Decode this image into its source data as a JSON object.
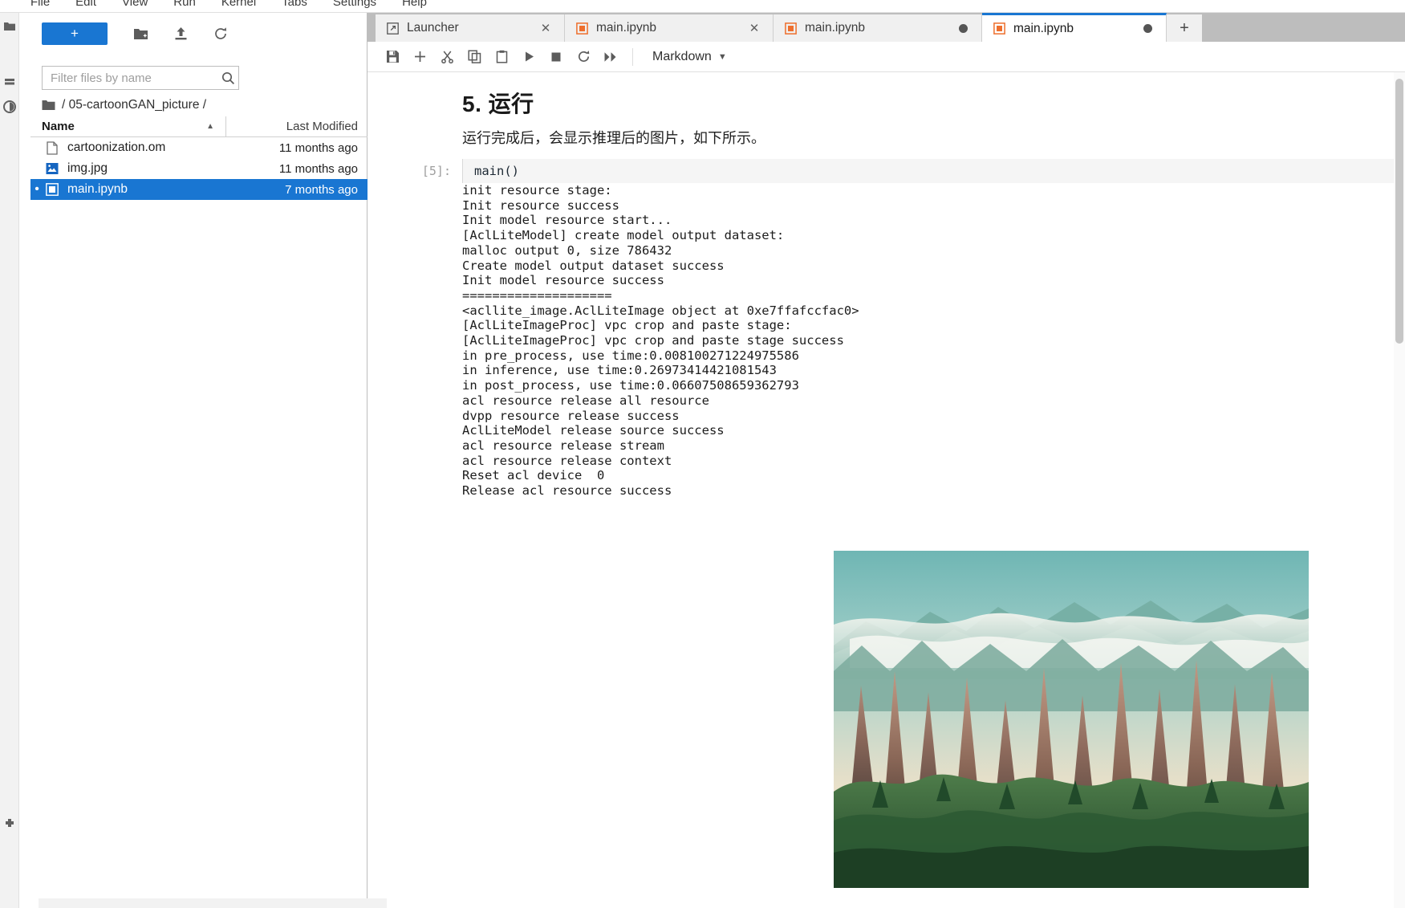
{
  "menubar": {
    "items": [
      {
        "label": "File"
      },
      {
        "label": "Edit"
      },
      {
        "label": "View"
      },
      {
        "label": "Run"
      },
      {
        "label": "Kernel"
      },
      {
        "label": "Tabs"
      },
      {
        "label": "Settings"
      },
      {
        "label": "Help"
      }
    ]
  },
  "rail": {
    "items": [
      {
        "name": "file-browser-icon",
        "label": "File Browser"
      },
      {
        "name": "running-terminals-icon",
        "label": "Running Terminals and Kernels"
      },
      {
        "name": "commands-icon",
        "label": "Commands"
      },
      {
        "name": "extension-manager-icon",
        "label": "Extension Manager"
      }
    ]
  },
  "file_browser": {
    "new_launcher_label": "+",
    "new_folder_label": "New Folder",
    "upload_label": "Upload Files",
    "refresh_label": "Refresh File List",
    "filter": {
      "placeholder": "Filter files by name",
      "value": ""
    },
    "breadcrumb": "/ 05-cartoonGAN_picture /",
    "columns": {
      "name": "Name",
      "last_modified": "Last Modified",
      "sort_direction": "ascending"
    },
    "files": [
      {
        "name": "cartoonization.om",
        "modified": "11 months ago",
        "icon": "generic-file-icon",
        "selected": false,
        "dirty": false
      },
      {
        "name": "img.jpg",
        "modified": "11 months ago",
        "icon": "image-file-icon",
        "selected": false,
        "dirty": false
      },
      {
        "name": "main.ipynb",
        "modified": "7 months ago",
        "icon": "notebook-file-icon",
        "selected": true,
        "dirty": true
      }
    ]
  },
  "tabs": {
    "items": [
      {
        "label": "Launcher",
        "icon": "launcher-icon",
        "active": false,
        "dirty": false,
        "closeable": true
      },
      {
        "label": "main.ipynb",
        "icon": "notebook-icon",
        "active": false,
        "dirty": false,
        "closeable": true
      },
      {
        "label": "main.ipynb",
        "icon": "notebook-icon",
        "active": false,
        "dirty": true,
        "closeable": false
      },
      {
        "label": "main.ipynb",
        "icon": "notebook-icon",
        "active": true,
        "dirty": true,
        "closeable": false
      }
    ],
    "add_label": "+"
  },
  "notebook_toolbar": {
    "buttons": [
      {
        "name": "save-button",
        "label": "Save"
      },
      {
        "name": "insert-cell-button",
        "label": "Insert a cell below"
      },
      {
        "name": "cut-button",
        "label": "Cut"
      },
      {
        "name": "copy-button",
        "label": "Copy"
      },
      {
        "name": "paste-button",
        "label": "Paste"
      },
      {
        "name": "run-button",
        "label": "Run"
      },
      {
        "name": "stop-button",
        "label": "Interrupt the kernel"
      },
      {
        "name": "restart-button",
        "label": "Restart the kernel"
      },
      {
        "name": "restart-run-all-button",
        "label": "Restart and run all"
      }
    ],
    "cell_type": "Markdown"
  },
  "notebook": {
    "heading": "5. 运行",
    "paragraph": "运行完成后，会显示推理后的图片，如下所示。",
    "cell": {
      "prompt": "[5]:",
      "source": "main()"
    },
    "output_lines": [
      "init resource stage:",
      "Init resource success",
      "Init model resource start...",
      "[AclLiteModel] create model output dataset:",
      "malloc output 0, size 786432",
      "Create model output dataset success",
      "Init model resource success",
      "====================",
      "<acllite_image.AclLiteImage object at 0xe7ffafccfac0>",
      "[AclLiteImageProc] vpc crop and paste stage:",
      "[AclLiteImageProc] vpc crop and paste stage success",
      "in pre_process, use time:0.008100271224975586",
      "in inference, use time:0.26973414421081543",
      "in post_process, use time:0.06607508659362793",
      "acl resource release all resource",
      "dvpp resource release success",
      "AclLiteModel release source success",
      "acl resource release stream",
      "acl resource release context",
      "Reset acl device  0",
      "Release acl resource success"
    ],
    "output_image_alt": "Cartoonized mountain landscape with karst peaks, green forest and pastel sky"
  },
  "colors": {
    "accent": "#1976d2",
    "tab_bar_bg": "#bdbdbd",
    "notebook_icon": "#ee6f2d",
    "selection_bg": "#1976d2",
    "output_bg": "#ffffff"
  }
}
